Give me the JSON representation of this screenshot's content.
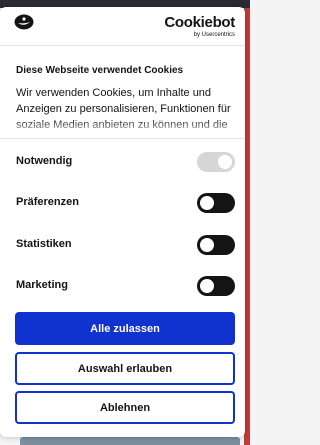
{
  "brand": {
    "name": "Cookiebot",
    "sub": "by Usercentrics"
  },
  "consent": {
    "title": "Diese Webseite verwendet Cookies",
    "description": "Wir verwenden Cookies, um Inhalte und Anzeigen zu personalisieren, Funktionen für soziale Medien anbieten zu können und die"
  },
  "toggles": [
    {
      "label": "Notwendig",
      "checked": true,
      "disabled": true
    },
    {
      "label": "Präferenzen",
      "checked": false,
      "disabled": false
    },
    {
      "label": "Statistiken",
      "checked": false,
      "disabled": false
    },
    {
      "label": "Marketing",
      "checked": false,
      "disabled": false
    }
  ],
  "buttons": {
    "allow_all": "Alle zulassen",
    "allow_selection": "Auswahl erlauben",
    "deny": "Ablehnen"
  },
  "colors": {
    "primary": "#1032cf",
    "toggle_on": "#141414",
    "toggle_disabled": "#d6d6d6"
  },
  "icons": {
    "logo": "cookiebot-logo-icon"
  }
}
